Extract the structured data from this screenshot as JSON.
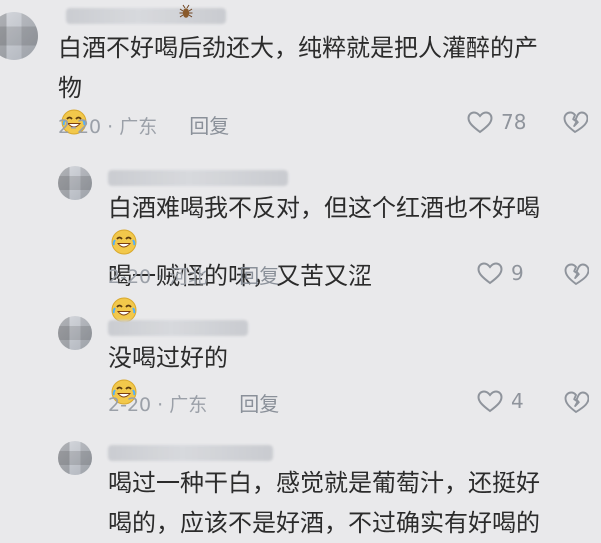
{
  "comments": [
    {
      "text_lines": [
        "白酒不好喝后劲还大，纯粹就是把人灌醉的产",
        "物"
      ],
      "date_loc": "2-20 · 广东",
      "reply_label": "回复",
      "likes": "78"
    },
    {
      "text_lines": [
        "白酒难喝我不反对，但这个红酒也不好喝",
        "喝一贼怪的味，又苦又涩"
      ],
      "date_loc": "2-20 · 河北",
      "reply_label": "回复",
      "likes": "9"
    },
    {
      "text_lines": [
        "没喝过好的"
      ],
      "date_loc": "2-20 · 广东",
      "reply_label": "回复",
      "likes": "4"
    },
    {
      "text_lines": [
        "喝过一种干白，感觉就是葡萄汁，还挺好",
        "喝的，应该不是好酒，不过确实有好喝的"
      ]
    }
  ],
  "icons": {
    "heart": "heart-outline-icon",
    "broken_heart": "broken-heart-icon",
    "emoji": "laughing-with-tears-emoji-icon",
    "bug": "cockroach-icon"
  },
  "colors": {
    "background": "#e9e9eb",
    "text": "#2b2b2b",
    "meta": "#9ba0a8",
    "emoji": "#f2c84b"
  }
}
